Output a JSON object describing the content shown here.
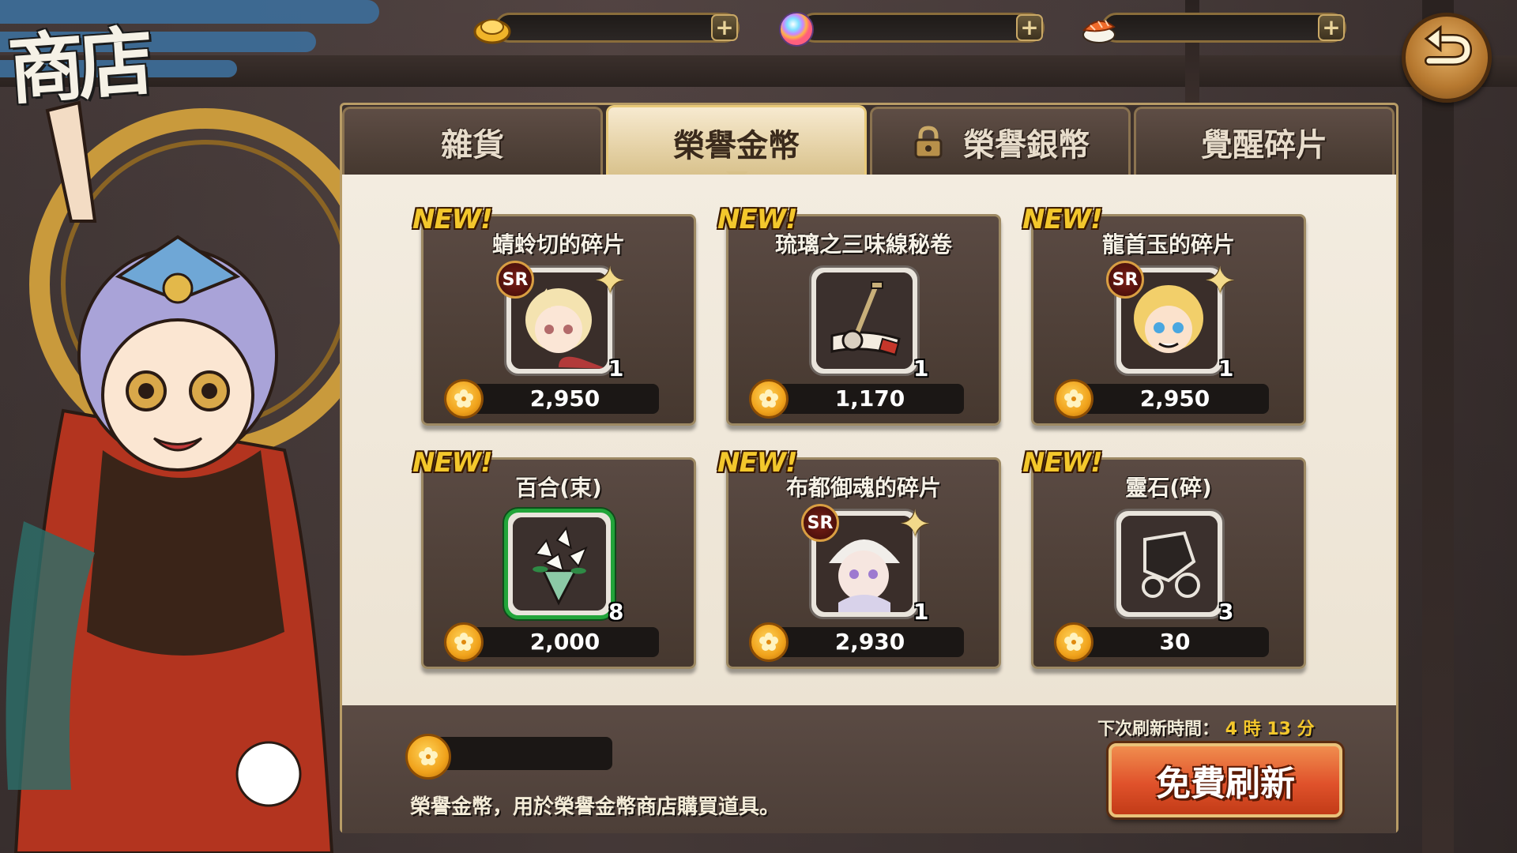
{
  "header": {
    "shop_title": "商店",
    "currencies": [
      {
        "icon": "gold-ingot-icon",
        "value": ""
      },
      {
        "icon": "rainbow-orb-icon",
        "value": ""
      },
      {
        "icon": "sushi-icon",
        "value": ""
      }
    ],
    "back_icon": "back-arrow-icon"
  },
  "tabs": [
    {
      "label": "雜貨",
      "active": false,
      "locked": false
    },
    {
      "label": "榮譽金幣",
      "active": true,
      "locked": false
    },
    {
      "label": "榮譽銀幣",
      "active": false,
      "locked": true
    },
    {
      "label": "覺醒碎片",
      "active": false,
      "locked": false
    }
  ],
  "items": [
    {
      "badge": "NEW!",
      "name": "蜻蛉切的碎片",
      "rarity": "SR",
      "qty": "1",
      "price": "2,950",
      "icon": "character-shard-icon"
    },
    {
      "badge": "NEW!",
      "name": "琉璃之三味線秘卷",
      "rarity": "",
      "qty": "1",
      "price": "1,170",
      "icon": "shamisen-scroll-icon"
    },
    {
      "badge": "NEW!",
      "name": "龍首玉的碎片",
      "rarity": "SR",
      "qty": "1",
      "price": "2,950",
      "icon": "character-shard-icon"
    },
    {
      "badge": "NEW!",
      "name": "百合(束)",
      "rarity": "",
      "qty": "8",
      "price": "2,000",
      "icon": "lily-bouquet-icon"
    },
    {
      "badge": "NEW!",
      "name": "布都御魂的碎片",
      "rarity": "SR",
      "qty": "1",
      "price": "2,930",
      "icon": "character-shard-icon"
    },
    {
      "badge": "NEW!",
      "name": "靈石(碎)",
      "rarity": "",
      "qty": "3",
      "price": "30",
      "icon": "spirit-stone-icon"
    }
  ],
  "footer": {
    "balance": "",
    "description": "榮譽金幣，用於榮譽金幣商店購買道具。",
    "timer_label": "下次刷新時間：",
    "timer_hours": "4",
    "timer_hours_unit": "時",
    "timer_minutes": "13",
    "timer_minutes_unit": "分",
    "refresh_button": "免費刷新"
  },
  "colors": {
    "accent_gold": "#f3c72c",
    "panel_brown": "#46382f",
    "refresh_red": "#e0522b",
    "active_tab": "#e6d3a8"
  }
}
